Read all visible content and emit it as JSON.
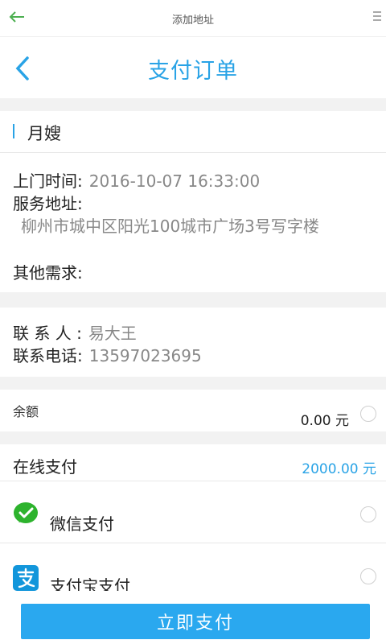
{
  "topbar": {
    "title": "添加地址"
  },
  "header": {
    "title": "支付订单"
  },
  "service": {
    "name": "月嫂"
  },
  "details": {
    "time_label": "上门时间:",
    "time_value": "2016-10-07 16:33:00",
    "address_label": "服务地址:",
    "address_value": "柳州市城中区阳光100城市广场3号写字楼",
    "other_label": "其他需求:"
  },
  "contact": {
    "name_label": "联 系 人 :",
    "name_value": "易大王",
    "phone_label": "联系电话:",
    "phone_value": "13597023695"
  },
  "balance": {
    "label": "余额",
    "value": "0.00 元"
  },
  "online": {
    "label": "在线支付",
    "amount": "2000.00 元"
  },
  "methods": [
    {
      "label": "微信支付",
      "icon": "wechat-icon"
    },
    {
      "label": "支付宝支付",
      "icon": "alipay-icon"
    }
  ],
  "submit": {
    "label": "立即支付"
  },
  "colors": {
    "accent": "#29a3e6",
    "button": "#2aa8ef",
    "wechat": "#2db32d",
    "alipay": "#1296db"
  }
}
